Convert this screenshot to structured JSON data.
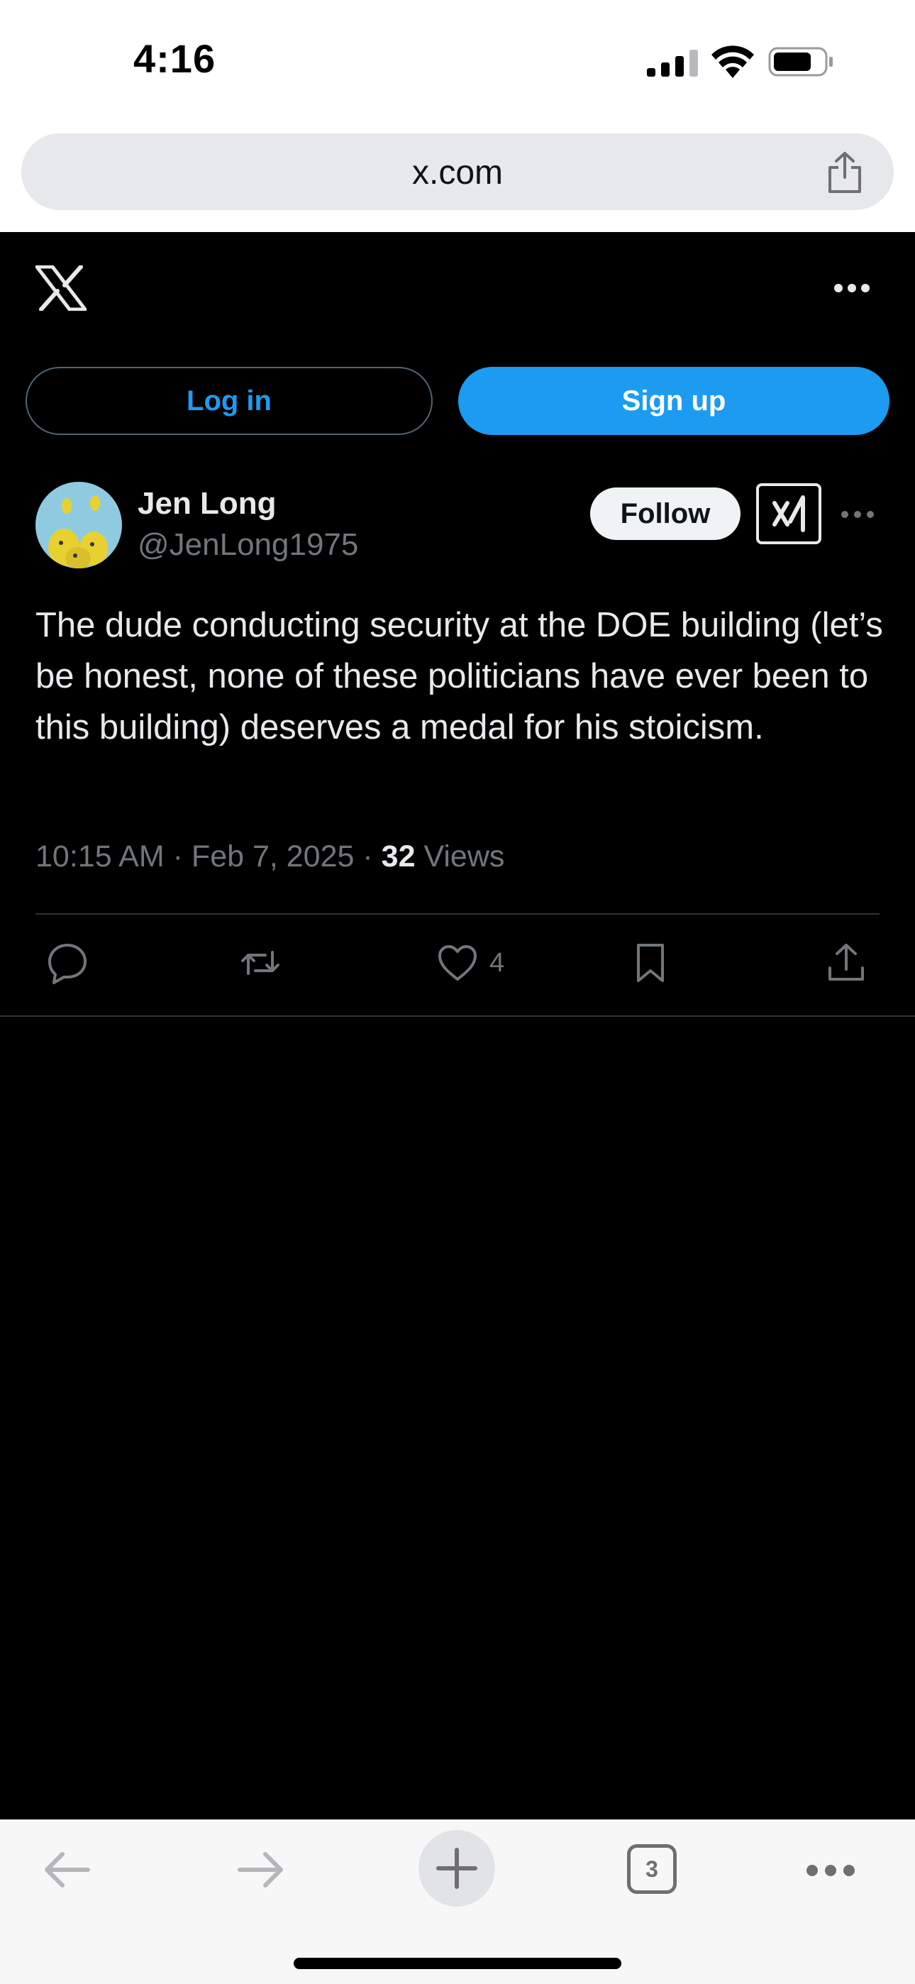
{
  "status_bar": {
    "time": "4:16",
    "icons": [
      "cellular-signal-icon",
      "wifi-icon",
      "battery-icon"
    ]
  },
  "browser": {
    "url": "x.com",
    "toolbar": {
      "tab_count": "3",
      "icons": [
        "back-arrow-icon",
        "forward-arrow-icon",
        "plus-icon",
        "tabs-icon",
        "more-dots-icon"
      ]
    }
  },
  "x_header": {
    "logo": "x-logo",
    "login_label": "Log in",
    "signup_label": "Sign up"
  },
  "tweet": {
    "author_name": "Jen Long",
    "author_handle": "@JenLong1975",
    "follow_label": "Follow",
    "text": "The dude conducting security at the DOE building (let’s be honest, none of these politicians have ever been to this building) deserves a medal for his stoicism.",
    "time": "10:15 AM",
    "separator": "·",
    "date": "Feb 7, 2025",
    "views_count": "32",
    "views_label": "Views",
    "like_count": "4"
  },
  "colors": {
    "accent": "#1d9bf0",
    "page_bg": "#000000",
    "text_primary": "#e7e9ea",
    "text_secondary": "#71767b",
    "divider": "#2f3336"
  }
}
